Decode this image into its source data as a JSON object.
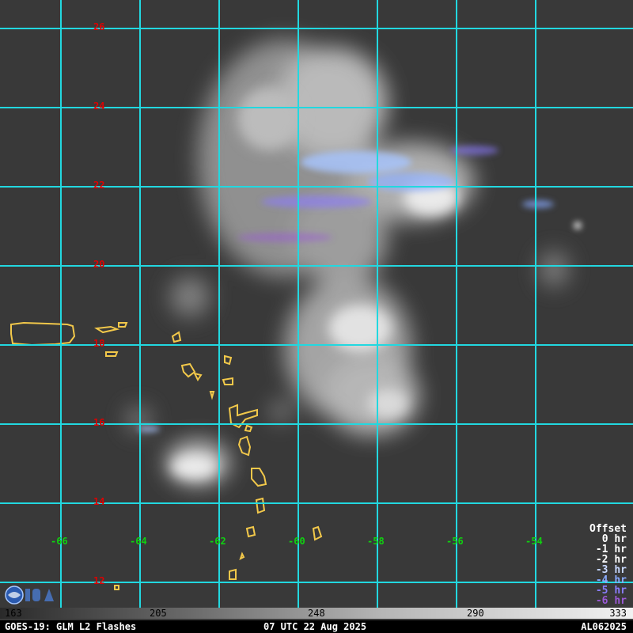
{
  "map": {
    "latitude_labels": [
      "26",
      "24",
      "22",
      "20",
      "18",
      "16",
      "14",
      "12"
    ],
    "longitude_labels": [
      "-66",
      "-64",
      "-62",
      "-60",
      "-58",
      "-56",
      "-54"
    ]
  },
  "offset_legend": {
    "title": "Offset",
    "rows": [
      {
        "label": "0 hr",
        "color": "#ffffff"
      },
      {
        "label": "-1 hr",
        "color": "#ffffff"
      },
      {
        "label": "-2 hr",
        "color": "#ffffff"
      },
      {
        "label": "-3 hr",
        "color": "#c8d8ff"
      },
      {
        "label": "-4 hr",
        "color": "#88aaff"
      },
      {
        "label": "-5 hr",
        "color": "#8a7dff"
      },
      {
        "label": "-6 hr",
        "color": "#9b5ad8"
      }
    ]
  },
  "colorbar": {
    "ticks": [
      "163",
      "205",
      "248",
      "290",
      "333"
    ]
  },
  "footer": {
    "left": "GOES-19: GLM L2 Flashes",
    "center": "07 UTC 22 Aug 2025",
    "right": "AL062025"
  },
  "colors": {
    "grid": "#22d8e0",
    "coastline": "#f2c84a",
    "lat_label": "#e00000",
    "lon_label": "#10d010"
  }
}
